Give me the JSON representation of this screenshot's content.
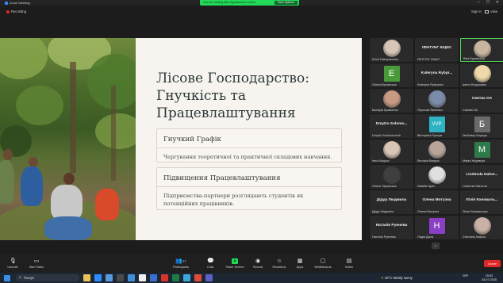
{
  "window": {
    "app_title": "Zoom Meeting",
    "viewing_banner": "You are viewing Віка Бурківська's screen",
    "view_options_label": "View Options",
    "minimize_glyph": "–",
    "maximize_glyph": "☐",
    "close_glyph": "✕"
  },
  "meeting": {
    "recording_label": "Recording",
    "sign_in_label": "Sign in",
    "view_label": "View"
  },
  "slide": {
    "title": "Лісове Господарство: Гнучкість та Працевлаштування",
    "cards": [
      {
        "heading": "Гнучкий Графік",
        "body": "Чергування теоретичної та практичної складових навчання."
      },
      {
        "heading": "Підвищення Працевлаштування",
        "body": "Підприємства-партнери розглядають студентів як потенційних працівників."
      }
    ]
  },
  "participants": [
    {
      "name": "Юлія Павлунішина",
      "kind": "photo",
      "color": "#d7c6b7"
    },
    {
      "name": "ІФНТУНГ КІЦКО",
      "kind": "text",
      "display": "ІФНТУНГ КІЦКО"
    },
    {
      "name": "Віка Бурківська",
      "kind": "photo",
      "color": "#c9b6a0",
      "highlight": true
    },
    {
      "name": "Олена Булаєська",
      "kind": "avatar",
      "letter": "E",
      "color": "#4a9a3a"
    },
    {
      "name": "Kateryna Rybpanko",
      "kind": "text",
      "display": "Kateryna Rybpr..."
    },
    {
      "name": "Ірина Федорович",
      "kind": "photo",
      "color": "#f0d9a8"
    },
    {
      "name": "Валерія Кравченко",
      "kind": "photo",
      "color": "#c89a82"
    },
    {
      "name": "Ярослав Ямненко",
      "kind": "photo",
      "color": "#7a8ca8"
    },
    {
      "name": "Святва ОА",
      "kind": "text",
      "display": "Святва ОА"
    },
    {
      "name": "Dmytro Solomonchuk",
      "kind": "text",
      "display": "Dmytro Solomo..."
    },
    {
      "name": "Вікторина Процик",
      "kind": "avatar",
      "letter": "VVP",
      "color": "#2fb3c4"
    },
    {
      "name": "Любомир Борщак",
      "kind": "avatar",
      "letter": "Б",
      "color": "#6a6a6a"
    },
    {
      "name": "Інна Мацько",
      "kind": "photo",
      "color": "#d9c5b5"
    },
    {
      "name": "Вікторія Вахура",
      "kind": "photo",
      "color": "#b8a59a"
    },
    {
      "name": "Марія Журавчук",
      "kind": "avatar",
      "letter": "M",
      "color": "#2f7a4a"
    },
    {
      "name": "Олеся Таранська",
      "kind": "photo",
      "color": "#3f3f3f"
    },
    {
      "name": "Nataliia Ilyan",
      "kind": "photo",
      "color": "#e0e0e0"
    },
    {
      "name": "Liudmula Nahorna",
      "kind": "text",
      "display": "Liudmula Nahor..."
    },
    {
      "name": "Дідур Людмила",
      "kind": "text",
      "display": "Дідур Людмила"
    },
    {
      "name": "Олена Мотузна",
      "kind": "text",
      "display": "Олена Мотузна"
    },
    {
      "name": "Лілія Коновальчук",
      "kind": "text",
      "display": "Лілія Коноваль..."
    },
    {
      "name": "Наталія Руннева",
      "kind": "text",
      "display": "Наталія Руннева"
    },
    {
      "name": "Надія Далік",
      "kind": "avatar",
      "letter": "H",
      "color": "#8a3fc4"
    },
    {
      "name": "Світлана Коваль",
      "kind": "photo",
      "color": "#c9b1a6"
    }
  ],
  "toolbar": {
    "unmute": "Unmute",
    "start_video": "Start Video",
    "participants": "Participants",
    "participants_count": "27",
    "chat": "Chat",
    "share_screen": "Share Screen",
    "record": "Record",
    "reactions": "Reactions",
    "apps": "Apps",
    "whiteboards": "Whiteboards",
    "notes": "Notes",
    "leave": "Leave"
  },
  "taskbar": {
    "search_placeholder": "Пошук",
    "weather": "29°C  Mostly sunny",
    "lang": "УКР",
    "time": "15:52",
    "date": "24.07.2025"
  }
}
